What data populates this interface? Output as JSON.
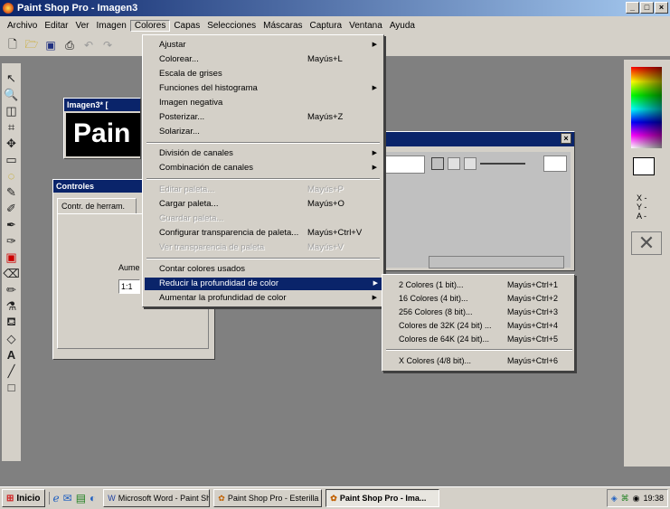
{
  "app": {
    "title": "Paint Shop Pro - Imagen3"
  },
  "menubar": [
    "Archivo",
    "Editar",
    "Ver",
    "Imagen",
    "Colores",
    "Capas",
    "Selecciones",
    "Máscaras",
    "Captura",
    "Ventana",
    "Ayuda"
  ],
  "image_window": {
    "title": "Imagen3* [",
    "canvas_text": "Pain"
  },
  "controls_window": {
    "title": "Controles",
    "tab": "Contr. de herram.",
    "label": "Aume",
    "zoom": "1:1"
  },
  "color_panel": {
    "x_label": "X -",
    "y_label": "Y -",
    "a_label": "A -"
  },
  "colores_menu": [
    {
      "label": "Ajustar",
      "shortcut": "",
      "submenu": true,
      "disabled": false
    },
    {
      "label": "Colorear...",
      "shortcut": "Mayús+L",
      "submenu": false,
      "disabled": false
    },
    {
      "label": "Escala de grises",
      "shortcut": "",
      "submenu": false,
      "disabled": false
    },
    {
      "label": "Funciones del histograma",
      "shortcut": "",
      "submenu": true,
      "disabled": false
    },
    {
      "label": "Imagen negativa",
      "shortcut": "",
      "submenu": false,
      "disabled": false
    },
    {
      "label": "Posterizar...",
      "shortcut": "Mayús+Z",
      "submenu": false,
      "disabled": false
    },
    {
      "label": "Solarizar...",
      "shortcut": "",
      "submenu": false,
      "disabled": false
    },
    {
      "label": "División de canales",
      "shortcut": "",
      "submenu": true,
      "disabled": false
    },
    {
      "label": "Combinación de canales",
      "shortcut": "",
      "submenu": true,
      "disabled": false
    },
    {
      "label": "Editar paleta...",
      "shortcut": "Mayús+P",
      "submenu": false,
      "disabled": true
    },
    {
      "label": "Cargar paleta...",
      "shortcut": "Mayús+O",
      "submenu": false,
      "disabled": false
    },
    {
      "label": "Guardar paleta...",
      "shortcut": "",
      "submenu": false,
      "disabled": true
    },
    {
      "label": "Configurar transparencia de paleta...",
      "shortcut": "Mayús+Ctrl+V",
      "submenu": false,
      "disabled": false
    },
    {
      "label": "Ver transparencia de paleta",
      "shortcut": "Mayús+V",
      "submenu": false,
      "disabled": true
    },
    {
      "label": "Contar colores usados",
      "shortcut": "",
      "submenu": false,
      "disabled": false
    },
    {
      "label": "Reducir la profundidad de color",
      "shortcut": "",
      "submenu": true,
      "disabled": false,
      "highlighted": true
    },
    {
      "label": "Aumentar la profundidad de color",
      "shortcut": "",
      "submenu": true,
      "disabled": false
    }
  ],
  "reduce_submenu": [
    {
      "label": "2 Colores (1 bit)...",
      "shortcut": "Mayús+Ctrl+1"
    },
    {
      "label": "16 Colores (4 bit)...",
      "shortcut": "Mayús+Ctrl+2"
    },
    {
      "label": "256 Colores (8 bit)...",
      "shortcut": "Mayús+Ctrl+3"
    },
    {
      "label": "Colores de 32K (24 bit) ...",
      "shortcut": "Mayús+Ctrl+4"
    },
    {
      "label": "Colores de 64K (24 bit)...",
      "shortcut": "Mayús+Ctrl+5"
    },
    {
      "label": "X Colores (4/8 bit)...",
      "shortcut": "Mayús+Ctrl+6"
    }
  ],
  "taskbar": {
    "start": "Inicio",
    "tasks": [
      "Microsoft Word - Paint Sh...",
      "Paint Shop Pro - Esterilla",
      "Paint Shop Pro - Ima..."
    ],
    "clock": "19:38"
  }
}
